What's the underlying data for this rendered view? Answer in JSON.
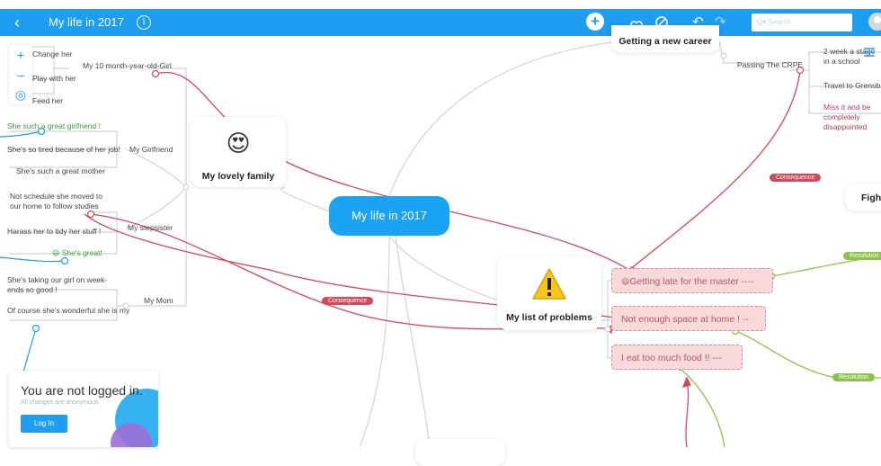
{
  "app": {
    "back": "‹",
    "title": "My life in 2017",
    "info": "i",
    "add": "+",
    "undo": "↶",
    "redo": "↷",
    "search_placeholder": "Q▾ Search"
  },
  "zoom": {
    "in": "+",
    "out": "–",
    "center": "◎"
  },
  "center": "My life in 2017",
  "family": {
    "emoji": "😍",
    "label": "My lovely family",
    "girl": "My 10 month-year-old-Girl",
    "girl_items": [
      "Change her",
      "Play with her",
      "Feed her"
    ],
    "girlfriend": "My Girlfriend",
    "gf_items": [
      "She such a great girlfriend !",
      "She's so tired because of her job!",
      "She's such a great mother"
    ],
    "stepsister": "My stepsister",
    "ss_items": [
      "Not schedule she moved to our home to follow studies",
      "Harass her to tidy her stuff !",
      "She's great!"
    ],
    "mom": "My Mom",
    "mom_items": [
      "She's taking our girl on week-ends so good !",
      "Of course she's wonderful she is my"
    ]
  },
  "career": {
    "label": "Getting a new career",
    "crpe": "Passing The CRPE",
    "items": [
      "2 week a stage in a school",
      "Travel to Grenoble",
      "Miss it and be completely disappointed"
    ],
    "fight": "Fight"
  },
  "problems": {
    "label": "My list of problems",
    "items": [
      "Getting late for the master ----",
      "Not enough space at home ! --",
      "I eat too much food !! ---"
    ]
  },
  "tags": {
    "consequence": "Consequence",
    "resolution": "Resolution"
  },
  "login": {
    "title": "You are not logged in.",
    "subtitle": "All changes are anonymous",
    "button": "Log In"
  },
  "colors": {
    "accent": "#1e9ef0",
    "link_red": "#d1495b",
    "link_green": "#8bc34a"
  }
}
